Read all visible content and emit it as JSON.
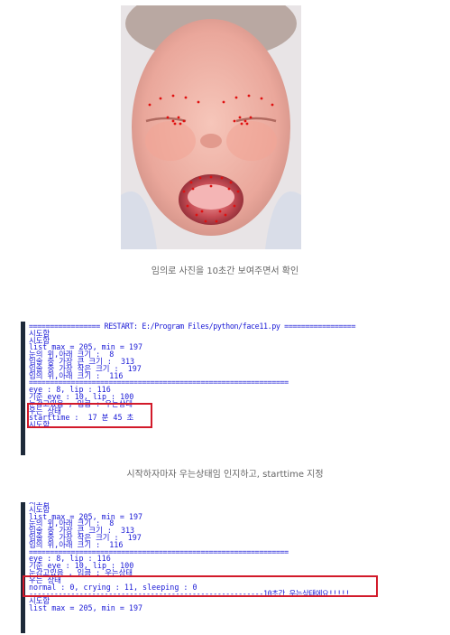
{
  "captions": {
    "photo": "임의로 사진을 10초간 보여주면서 확인",
    "console1": "시작하자마자 우는상태임 인지하고, starttime 지정"
  },
  "console1": {
    "lines": [
      "================= RESTART: E:/Program Files/python/face11.py =================",
      "시도함",
      "시도함",
      "list max = 205, min = 197",
      "눈의 위,아래 크기 :  8",
      "입술 중 가장 큰 크기 :  313",
      "입술 중 가장 작은 크기 :  197",
      "입의 위,아래 크기 :  116",
      "==============================================================",
      "eye : 8, lip : 116",
      "기준 eye : 10, lip : 100",
      "눈감고있음 , 입큼 : 우는상태",
      "우는 상태",
      "starttime :  17 분 45 초",
      "시도함"
    ]
  },
  "console2": {
    "lines": [
      "시도함",
      "시도함",
      "list max = 205, min = 197",
      "눈의 위,아래 크기 :  8",
      "입술 중 가장 큰 크기 :  313",
      "입술 중 가장 작은 크기 :  197",
      "입의 위,아래 크기 :  116",
      "==============================================================",
      "eye : 8, lip : 116",
      "기준 eye : 10, lip : 100",
      "눈감고있음 , 입큼 : 우는상태",
      "우는 상태",
      "normal : 0, crying : 11, sleeping : 0",
      "--------------------------------------------------------10초간 우는상태에요!!!!!",
      "시도함",
      "list max = 205, min = 197"
    ]
  },
  "colors": {
    "console_text": "#1a1ad6",
    "highlight": "#d21a2a",
    "landmark": "#e01010"
  }
}
